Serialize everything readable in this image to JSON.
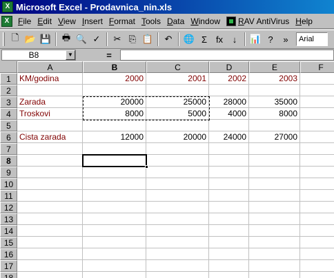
{
  "window": {
    "title": "Microsoft Excel - Prodavnica_nin.xls",
    "app_icon": "X"
  },
  "menu": {
    "doc_icon": "X",
    "items": [
      {
        "label": "File",
        "u": "F",
        "rest": "ile"
      },
      {
        "label": "Edit",
        "u": "E",
        "rest": "dit"
      },
      {
        "label": "View",
        "u": "V",
        "rest": "iew"
      },
      {
        "label": "Insert",
        "u": "I",
        "rest": "nsert"
      },
      {
        "label": "Format",
        "u": "F",
        "rest": "ormat"
      },
      {
        "label": "Tools",
        "u": "T",
        "rest": "ools"
      },
      {
        "label": "Data",
        "u": "D",
        "rest": "ata"
      },
      {
        "label": "Window",
        "u": "W",
        "rest": "indow"
      }
    ],
    "rav": {
      "u": "R",
      "rest": "AV AntiVirus"
    },
    "help": {
      "u": "H",
      "rest": "elp"
    }
  },
  "toolbar": {
    "glyphs": {
      "new": "🗋",
      "open": "📂",
      "save": "💾",
      "print": "🖶",
      "preview": "🔍",
      "spell": "✓",
      "cut": "✂",
      "copy": "⎘",
      "paste": "📋",
      "undo": "↶",
      "web": "🌐",
      "sum": "Σ",
      "function": "fx",
      "sort": "↓",
      "chart": "📊",
      "help": "?",
      "more": "»"
    },
    "font": "Arial"
  },
  "formula_bar": {
    "name_box": "B8",
    "equals": "=",
    "content": ""
  },
  "columns": [
    "A",
    "B",
    "C",
    "D",
    "E",
    "F"
  ],
  "active_column": "B",
  "active_row": "8",
  "rows": [
    {
      "n": "1",
      "cells": [
        "KM/godina",
        "2000",
        "2001",
        "2002",
        "2003",
        ""
      ]
    },
    {
      "n": "2",
      "cells": [
        "",
        "",
        "",
        "",
        "",
        ""
      ]
    },
    {
      "n": "3",
      "cells": [
        "Zarada",
        "20000",
        "25000",
        "28000",
        "35000",
        ""
      ]
    },
    {
      "n": "4",
      "cells": [
        "Troskovi",
        "8000",
        "5000",
        "4000",
        "8000",
        ""
      ]
    },
    {
      "n": "5",
      "cells": [
        "",
        "",
        "",
        "",
        "",
        ""
      ]
    },
    {
      "n": "6",
      "cells": [
        "Cista zarada",
        "12000",
        "20000",
        "24000",
        "27000",
        ""
      ]
    },
    {
      "n": "7",
      "cells": [
        "",
        "",
        "",
        "",
        "",
        ""
      ]
    },
    {
      "n": "8",
      "cells": [
        "",
        "",
        "",
        "",
        "",
        ""
      ]
    },
    {
      "n": "9",
      "cells": [
        "",
        "",
        "",
        "",
        "",
        ""
      ]
    },
    {
      "n": "10",
      "cells": [
        "",
        "",
        "",
        "",
        "",
        ""
      ]
    },
    {
      "n": "11",
      "cells": [
        "",
        "",
        "",
        "",
        "",
        ""
      ]
    },
    {
      "n": "12",
      "cells": [
        "",
        "",
        "",
        "",
        "",
        ""
      ]
    },
    {
      "n": "13",
      "cells": [
        "",
        "",
        "",
        "",
        "",
        ""
      ]
    },
    {
      "n": "14",
      "cells": [
        "",
        "",
        "",
        "",
        "",
        ""
      ]
    },
    {
      "n": "15",
      "cells": [
        "",
        "",
        "",
        "",
        "",
        ""
      ]
    },
    {
      "n": "16",
      "cells": [
        "",
        "",
        "",
        "",
        "",
        ""
      ]
    },
    {
      "n": "17",
      "cells": [
        "",
        "",
        "",
        "",
        "",
        ""
      ]
    },
    {
      "n": "18",
      "cells": [
        "",
        "",
        "",
        "",
        "",
        ""
      ]
    }
  ],
  "colors": {
    "maroon_text": "#800000",
    "title_bar": "#000080"
  }
}
